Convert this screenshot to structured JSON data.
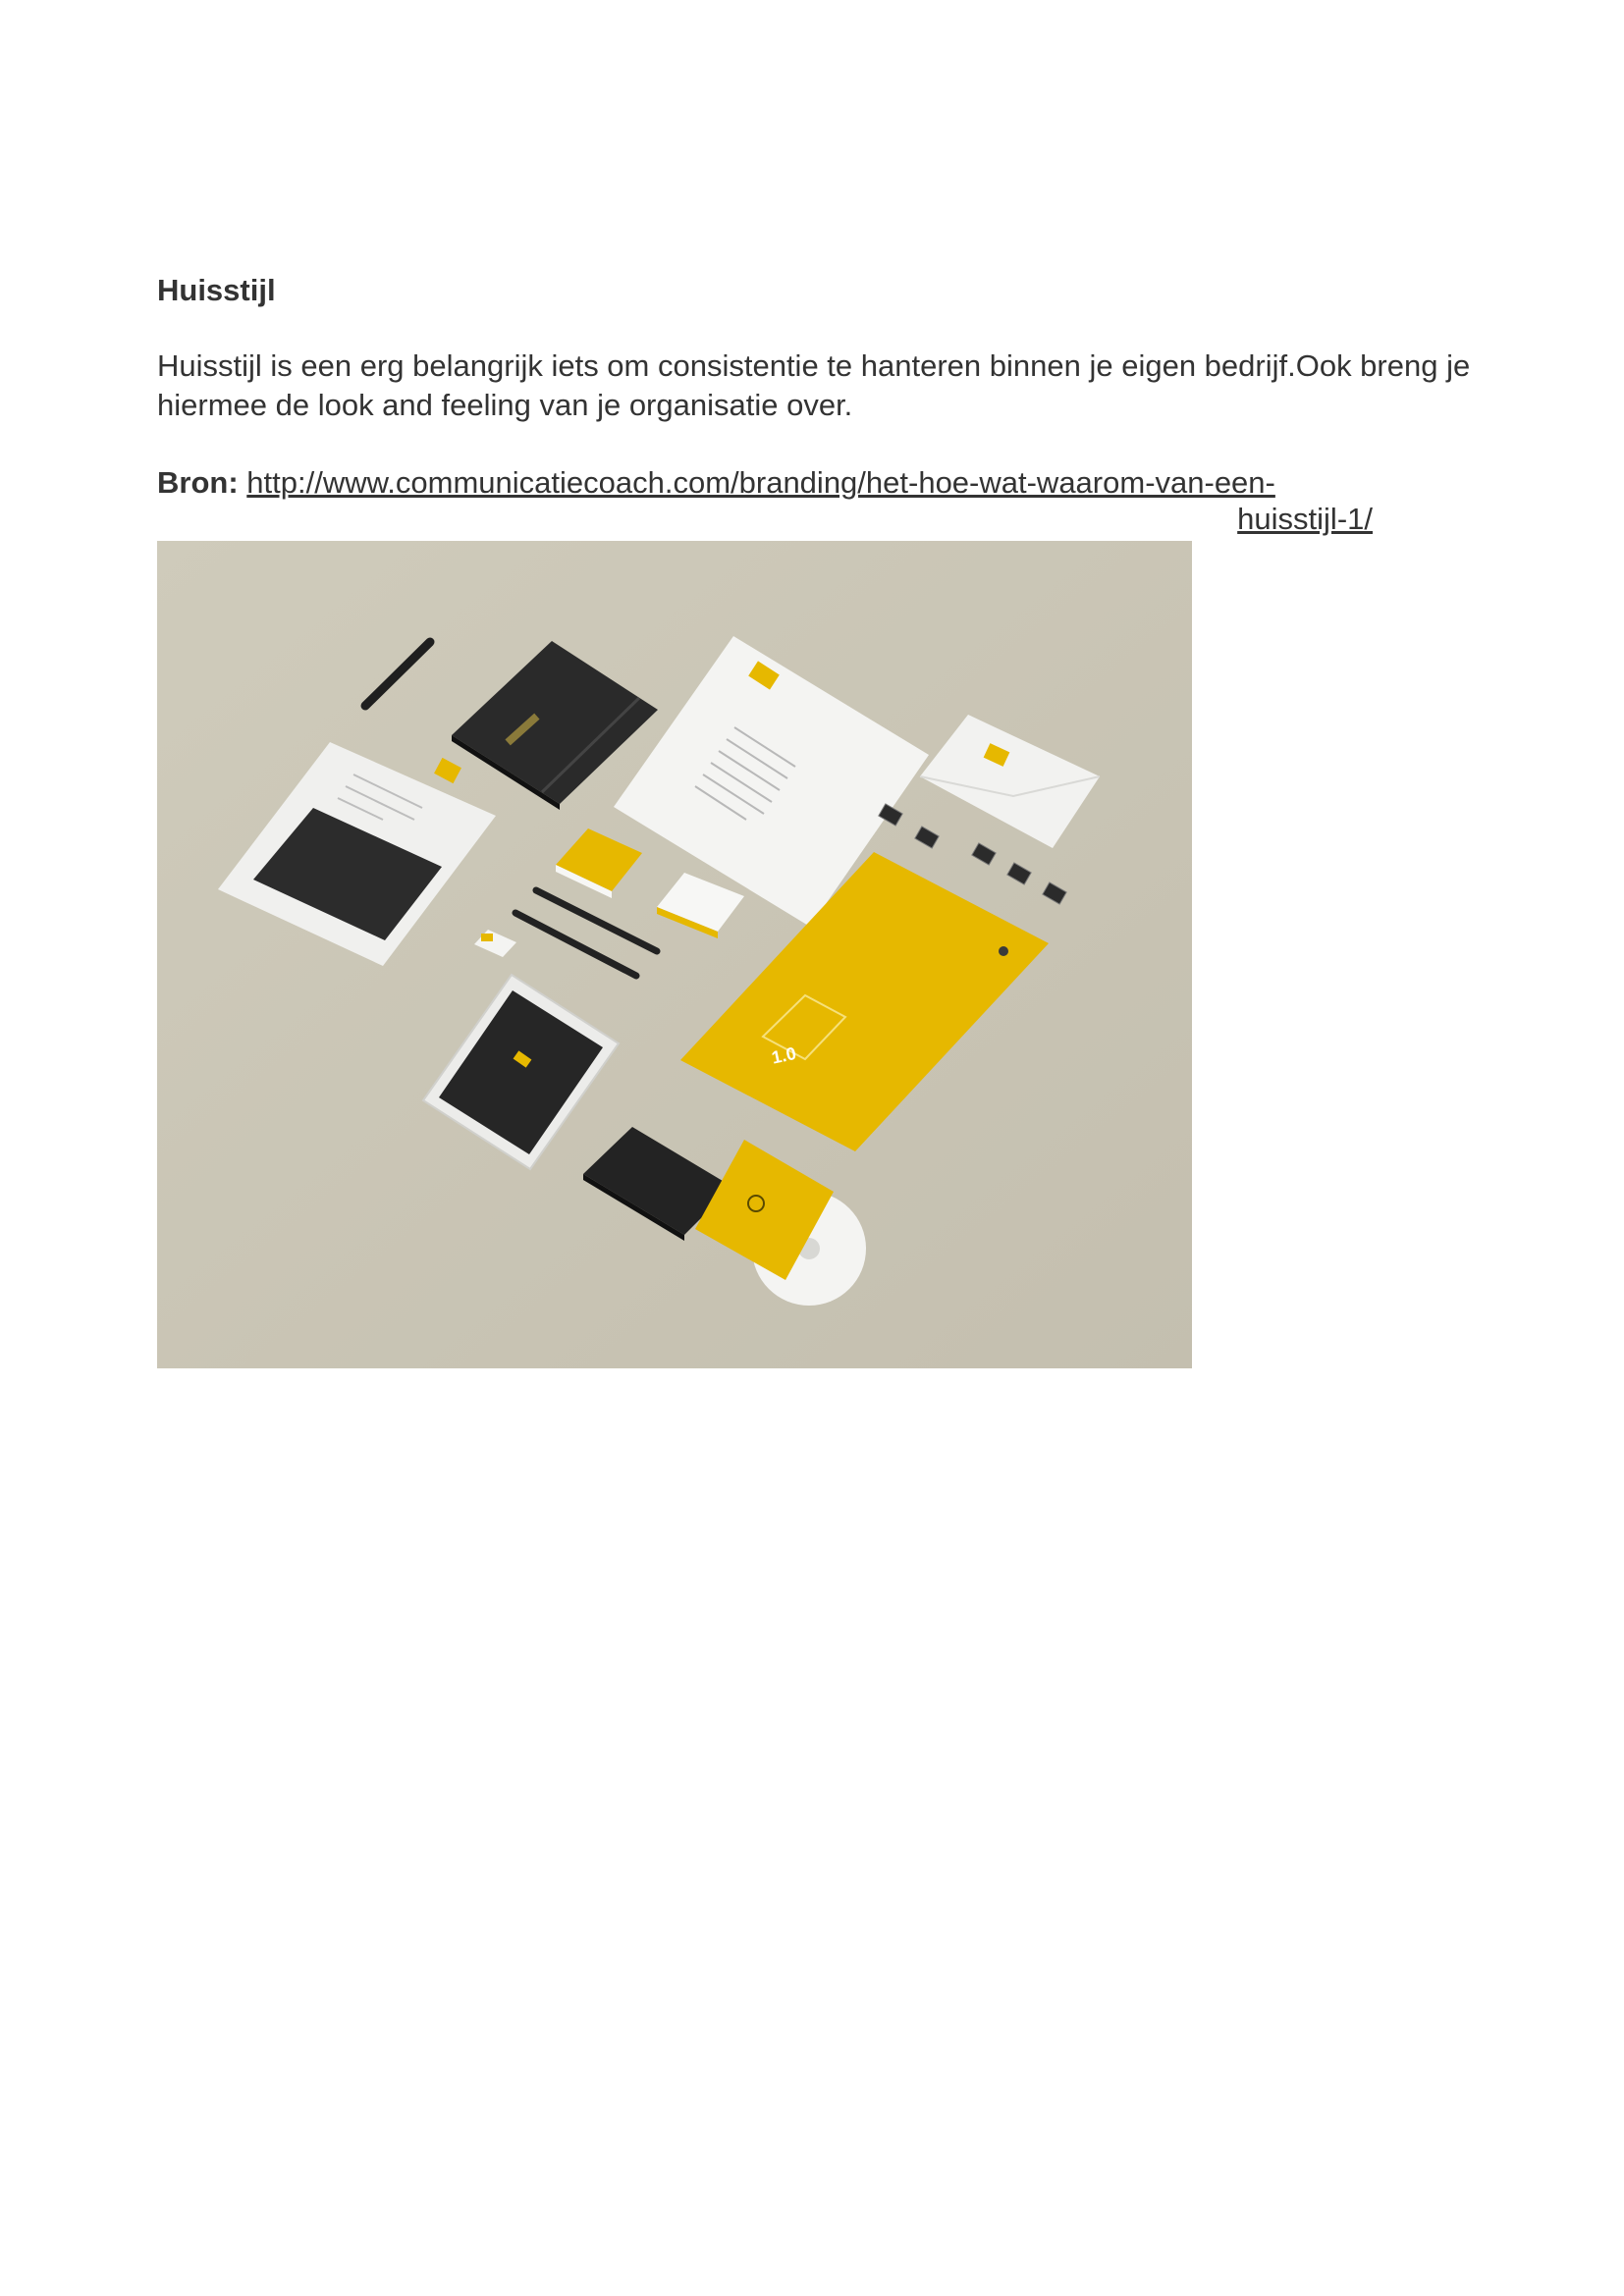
{
  "document": {
    "heading": "Huisstijl",
    "paragraph": "Huisstijl is een erg belangrijk iets om consistentie te hanteren binnen je eigen bedrijf.Ook breng je hiermee de look and feeling van je organisatie over.",
    "source_label": "Bron:",
    "source_url_line1": "http://www.communicatiecoach.com/branding/het-hoe-wat-waarom-van-een-",
    "source_url_line2": "huisstijl-1/",
    "image": {
      "description_icon": "stationery-mockup-image",
      "colors": {
        "background": "#cdc8b7",
        "yellow": "#e6b800",
        "black": "#2a2a2a",
        "white": "#f4f4f2"
      },
      "visible_text": {
        "folder_number": "1.0"
      }
    }
  }
}
